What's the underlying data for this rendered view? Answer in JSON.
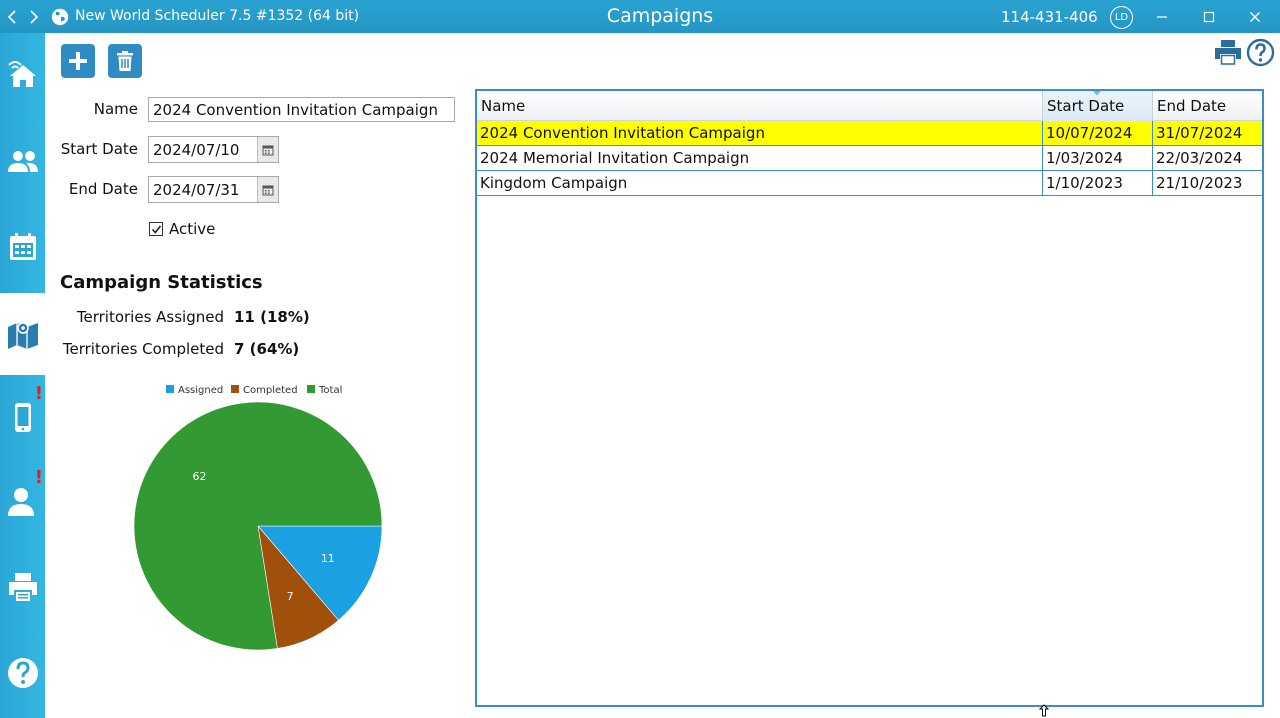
{
  "titlebar": {
    "app_name": "New World Scheduler 7.5 #1352 (64 bit)",
    "page_title": "Campaigns",
    "account_id": "114-431-406",
    "avatar_initials": "LD"
  },
  "sidebar": {
    "items": [
      {
        "icon": "home-wifi-icon",
        "active": false,
        "badge": ""
      },
      {
        "icon": "people-icon",
        "active": false,
        "badge": ""
      },
      {
        "icon": "calendar-icon",
        "active": false,
        "badge": ""
      },
      {
        "icon": "map-icon",
        "active": true,
        "badge": ""
      },
      {
        "icon": "mobile-icon",
        "active": false,
        "badge": "!"
      },
      {
        "icon": "user-icon",
        "active": false,
        "badge": "!"
      },
      {
        "icon": "printer-icon",
        "active": false,
        "badge": ""
      },
      {
        "icon": "help-icon",
        "active": false,
        "badge": ""
      }
    ]
  },
  "form": {
    "name_label": "Name",
    "name_value": "2024 Convention Invitation Campaign",
    "start_label": "Start Date",
    "start_value": "2024/07/10",
    "end_label": "End Date",
    "end_value": "2024/07/31",
    "active_label": "Active",
    "active_checked": true
  },
  "stats": {
    "title": "Campaign Statistics",
    "assigned_label": "Territories Assigned",
    "assigned_value": "11 (18%)",
    "completed_label": "Territories Completed",
    "completed_value": "7 (64%)"
  },
  "chart_data": {
    "type": "pie",
    "categories": [
      "Assigned",
      "Completed",
      "Total"
    ],
    "values": [
      11,
      7,
      62
    ],
    "colors": [
      "#1ba1e2",
      "#a0500a",
      "#339933"
    ],
    "legend": "top"
  },
  "grid": {
    "columns": [
      "Name",
      "Start Date",
      "End Date"
    ],
    "sorted_column": 1,
    "rows": [
      {
        "name": "2024 Convention Invitation Campaign",
        "start": "10/07/2024",
        "end": "31/07/2024",
        "selected": true
      },
      {
        "name": "2024 Memorial Invitation Campaign",
        "start": "1/03/2024",
        "end": "22/03/2024",
        "selected": false
      },
      {
        "name": "Kingdom Campaign",
        "start": "1/10/2023",
        "end": "21/10/2023",
        "selected": false
      }
    ]
  },
  "colors": {
    "accent": "#2aa3d2",
    "selection": "#ffff00",
    "grid_border": "#3a8fc0"
  }
}
